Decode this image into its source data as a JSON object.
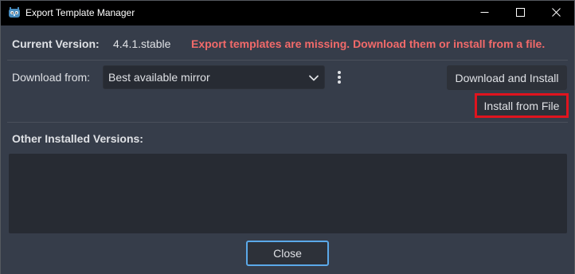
{
  "window": {
    "title": "Export Template Manager",
    "app_icon": "godot-icon",
    "controls": {
      "minimize": "minimize-icon",
      "maximize": "maximize-icon",
      "close": "close-icon"
    }
  },
  "version": {
    "label": "Current Version:",
    "value": "4.4.1.stable",
    "warning": "Export templates are missing. Download them or install from a file."
  },
  "download": {
    "label": "Download from:",
    "selected_mirror": "Best available mirror",
    "more_icon": "kebab-menu-icon",
    "download_button": "Download and Install",
    "install_button": "Install from File"
  },
  "installed": {
    "label": "Other Installed Versions:",
    "items": []
  },
  "footer": {
    "close_button": "Close"
  },
  "colors": {
    "background": "#363d4a",
    "panel": "#272b33",
    "warning": "#f26a6a",
    "focus": "#5ba9e9",
    "highlight_box": "#e0141e"
  }
}
